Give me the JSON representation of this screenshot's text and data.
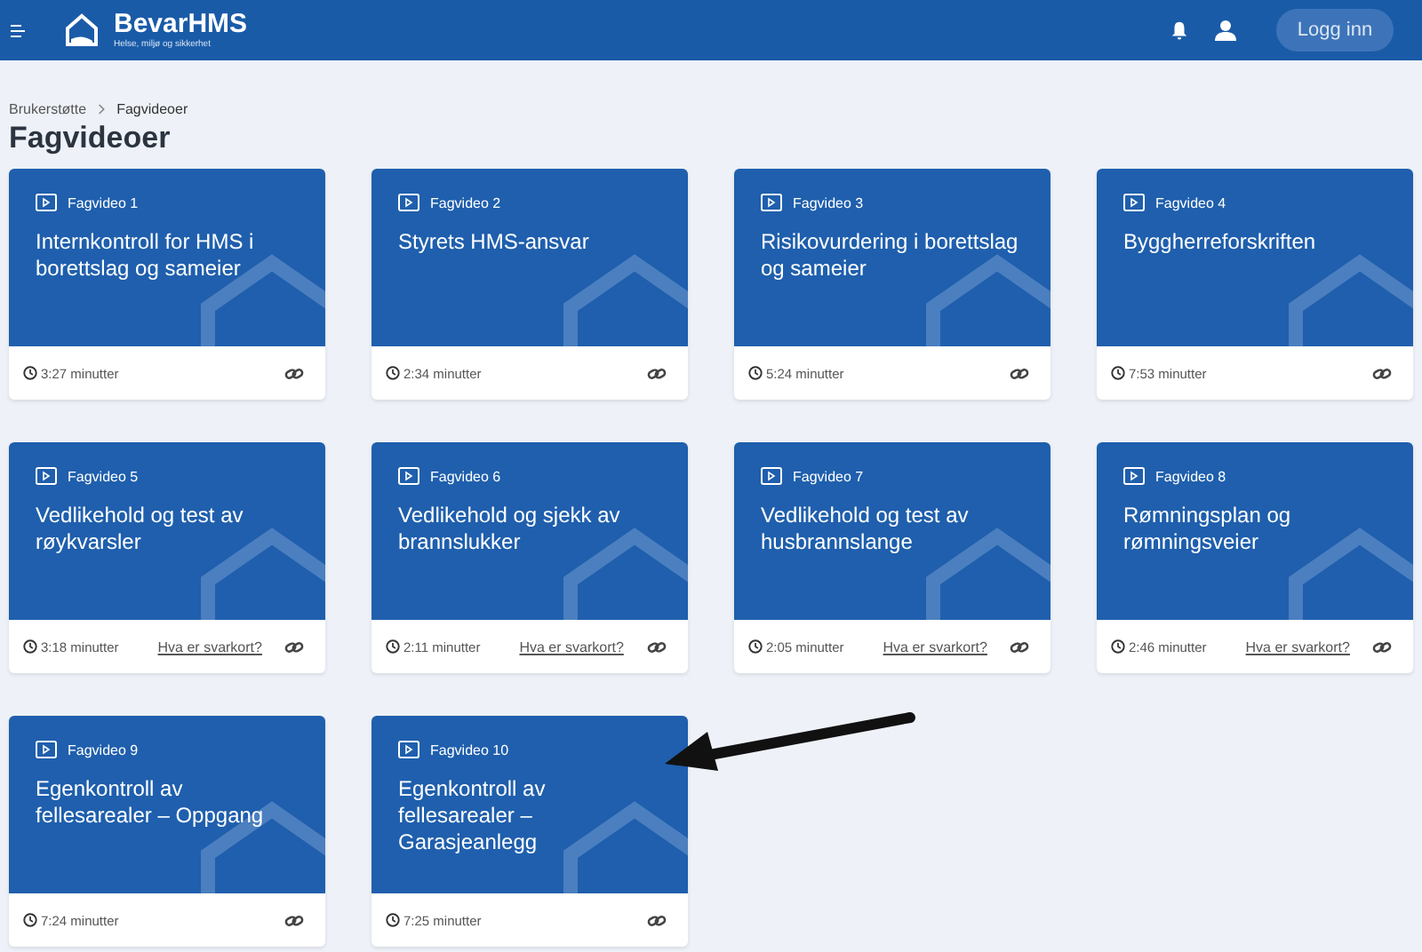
{
  "header": {
    "brand": "BevarHMS",
    "tagline": "Helse, miljø og sikkerhet",
    "login_button": "Logg inn"
  },
  "breadcrumb": [
    {
      "label": "Brukerstøtte",
      "selected": false
    },
    {
      "label": "Fagvideoer",
      "selected": true
    }
  ],
  "page_title": "Fagvideoer",
  "videos": [
    {
      "label": "Fagvideo 1",
      "title": "Internkontroll for HMS i borettslag og sameier",
      "duration": "3:27 minutter"
    },
    {
      "label": "Fagvideo 2",
      "title": "Styrets HMS-ansvar",
      "duration": "2:34 minutter"
    },
    {
      "label": "Fagvideo 3",
      "title": "Risikovurdering i borettslag og sameier",
      "duration": "5:24 minutter"
    },
    {
      "label": "Fagvideo 4",
      "title": "Byggherreforskriften",
      "duration": "7:53 minutter"
    },
    {
      "label": "Fagvideo 5",
      "title": "Vedlikehold og test av røykvarsler",
      "duration": "3:18 minutter",
      "answer_link": "Hva er svarkort?"
    },
    {
      "label": "Fagvideo 6",
      "title": "Vedlikehold og sjekk av brannslukker",
      "duration": "2:11 minutter",
      "answer_link": "Hva er svarkort?"
    },
    {
      "label": "Fagvideo 7",
      "title": "Vedlikehold og test av husbrannslange",
      "duration": "2:05 minutter",
      "answer_link": "Hva er svarkort?"
    },
    {
      "label": "Fagvideo 8",
      "title": "Rømningsplan og rømningsveier",
      "duration": "2:46 minutter",
      "answer_link": "Hva er svarkort?"
    },
    {
      "label": "Fagvideo 9",
      "title": "Egenkontroll av fellesarealer – Oppgang",
      "duration": "7:24 minutter"
    },
    {
      "label": "Fagvideo 10",
      "title": "Egenkontroll av fellesarealer – Garasjeanlegg",
      "duration": "7:25 minutter"
    }
  ]
}
